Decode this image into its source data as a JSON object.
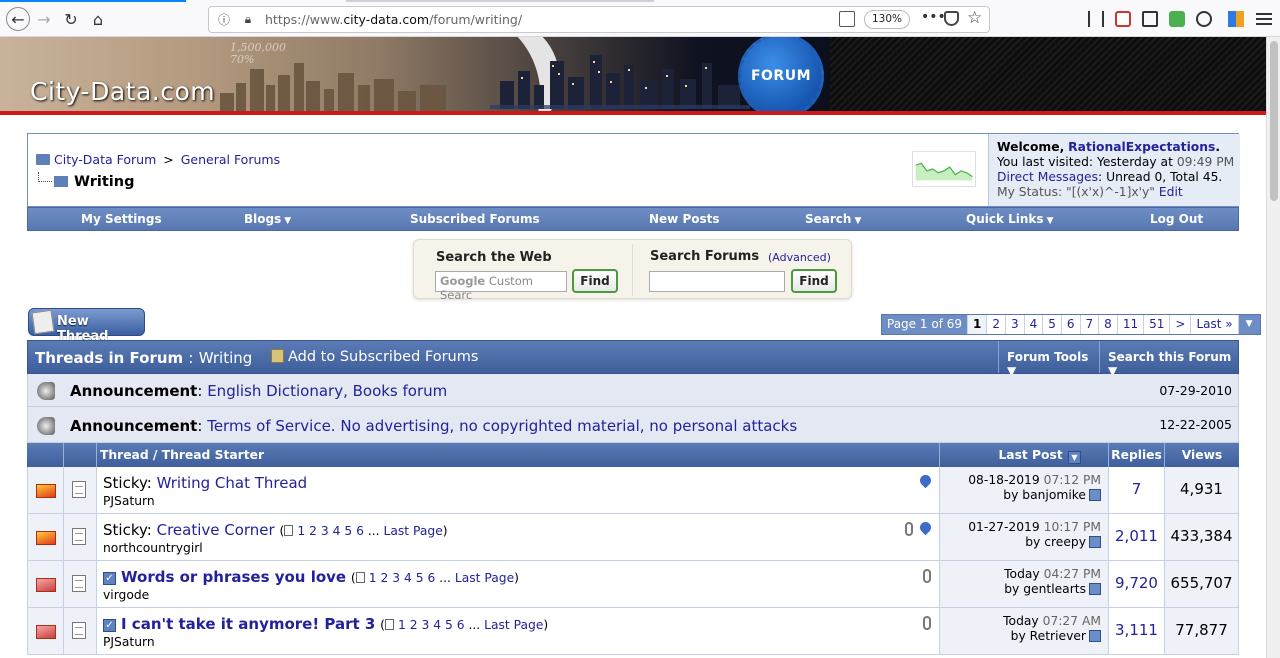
{
  "browser": {
    "url_prefix": "https://www.",
    "url_domain": "city-data.com",
    "url_path": "/forum/writing/",
    "zoom": "130%",
    "more": "•••"
  },
  "banner": {
    "logo": "City-Data.com",
    "population": "1,500,000",
    "percent": "70%",
    "badge": "FORUM"
  },
  "breadcrumb": {
    "root": "City-Data Forum",
    "sep": ">",
    "parent": "General Forums",
    "current": "Writing"
  },
  "welcome": {
    "prefix": "Welcome,",
    "user": "RationalExpectations",
    "dot": ".",
    "last_visited_label": "You last visited: Yesterday at",
    "last_visited_time": "09:49 PM",
    "dm_label": "Direct Messages",
    "dm_value": ": Unread 0, Total 45.",
    "status_label": "My Status: \"[(x'x)^-1]x'y\"",
    "status_edit": "Edit"
  },
  "navbar": [
    {
      "label": "My Settings",
      "caret": ""
    },
    {
      "label": "Blogs",
      "caret": "▼"
    },
    {
      "label": "Subscribed Forums",
      "caret": ""
    },
    {
      "label": "New Posts",
      "caret": ""
    },
    {
      "label": "Search",
      "caret": "▼"
    },
    {
      "label": "Quick Links",
      "caret": "▼"
    },
    {
      "label": "Log Out",
      "caret": ""
    }
  ],
  "search": {
    "web_label": "Search the Web",
    "web_placeholder_brand": "Google",
    "web_placeholder": "Custom Searc",
    "find": "Find",
    "forums_label": "Search Forums",
    "advanced": "(Advanced)",
    "forums_value": ""
  },
  "new_thread": "New Thread",
  "pager": {
    "label": "Page 1 of 69",
    "pages": [
      "1",
      "2",
      "3",
      "4",
      "5",
      "6",
      "7",
      "8",
      "11",
      "51",
      ">",
      "Last »"
    ],
    "current": "1",
    "drop": "▼"
  },
  "forum_head": {
    "title": "Threads in Forum",
    "title_sep": ":",
    "forum": "Writing",
    "subscribe": "Add to Subscribed Forums",
    "tools": "Forum Tools ▼",
    "search": "Search this Forum ▼"
  },
  "announcements": [
    {
      "label": "Announcement",
      "colon": ":",
      "title": "English Dictionary, Books forum",
      "date": "07-29-2010"
    },
    {
      "label": "Announcement",
      "colon": ":",
      "title": "Terms of Service. No advertising, no copyrighted material, no personal attacks",
      "date": "12-22-2005"
    }
  ],
  "table_head": {
    "thread": "Thread / Thread Starter",
    "last_post": "Last Post",
    "sort_mark": "▼",
    "replies": "Replies",
    "views": "Views"
  },
  "threads": [
    {
      "prefix": "Sticky:",
      "title": "Writing Chat Thread",
      "pages": [],
      "last_page": "",
      "starter": "PJSaturn",
      "date": "08-18-2019",
      "time": "07:12 PM",
      "by": "by",
      "user": "banjomike",
      "replies": "7",
      "views": "4,931"
    },
    {
      "prefix": "Sticky:",
      "title": "Creative Corner",
      "pages": [
        "1",
        "2",
        "3",
        "4",
        "5",
        "6"
      ],
      "last_page": "Last Page",
      "starter": "northcountrygirl",
      "date": "01-27-2019",
      "time": "10:17 PM",
      "by": "by",
      "user": "creepy",
      "replies": "2,011",
      "views": "433,384"
    },
    {
      "prefix": "",
      "title": "Words or phrases you love",
      "pages": [
        "1",
        "2",
        "3",
        "4",
        "5",
        "6"
      ],
      "last_page": "Last Page",
      "starter": "virgode",
      "date": "Today",
      "time": "04:27 PM",
      "by": "by",
      "user": "gentlearts",
      "replies": "9,720",
      "views": "655,707"
    },
    {
      "prefix": "",
      "title": "I can't take it anymore! Part 3",
      "pages": [
        "1",
        "2",
        "3",
        "4",
        "5",
        "6"
      ],
      "last_page": "Last Page",
      "starter": "PJSaturn",
      "date": "Today",
      "time": "07:27 AM",
      "by": "by",
      "user": "Retriever",
      "replies": "3,111",
      "views": "77,877"
    }
  ],
  "pages_open": "(",
  "pages_ellipsis": "...",
  "pages_close": ")",
  "checkmark": "✓"
}
